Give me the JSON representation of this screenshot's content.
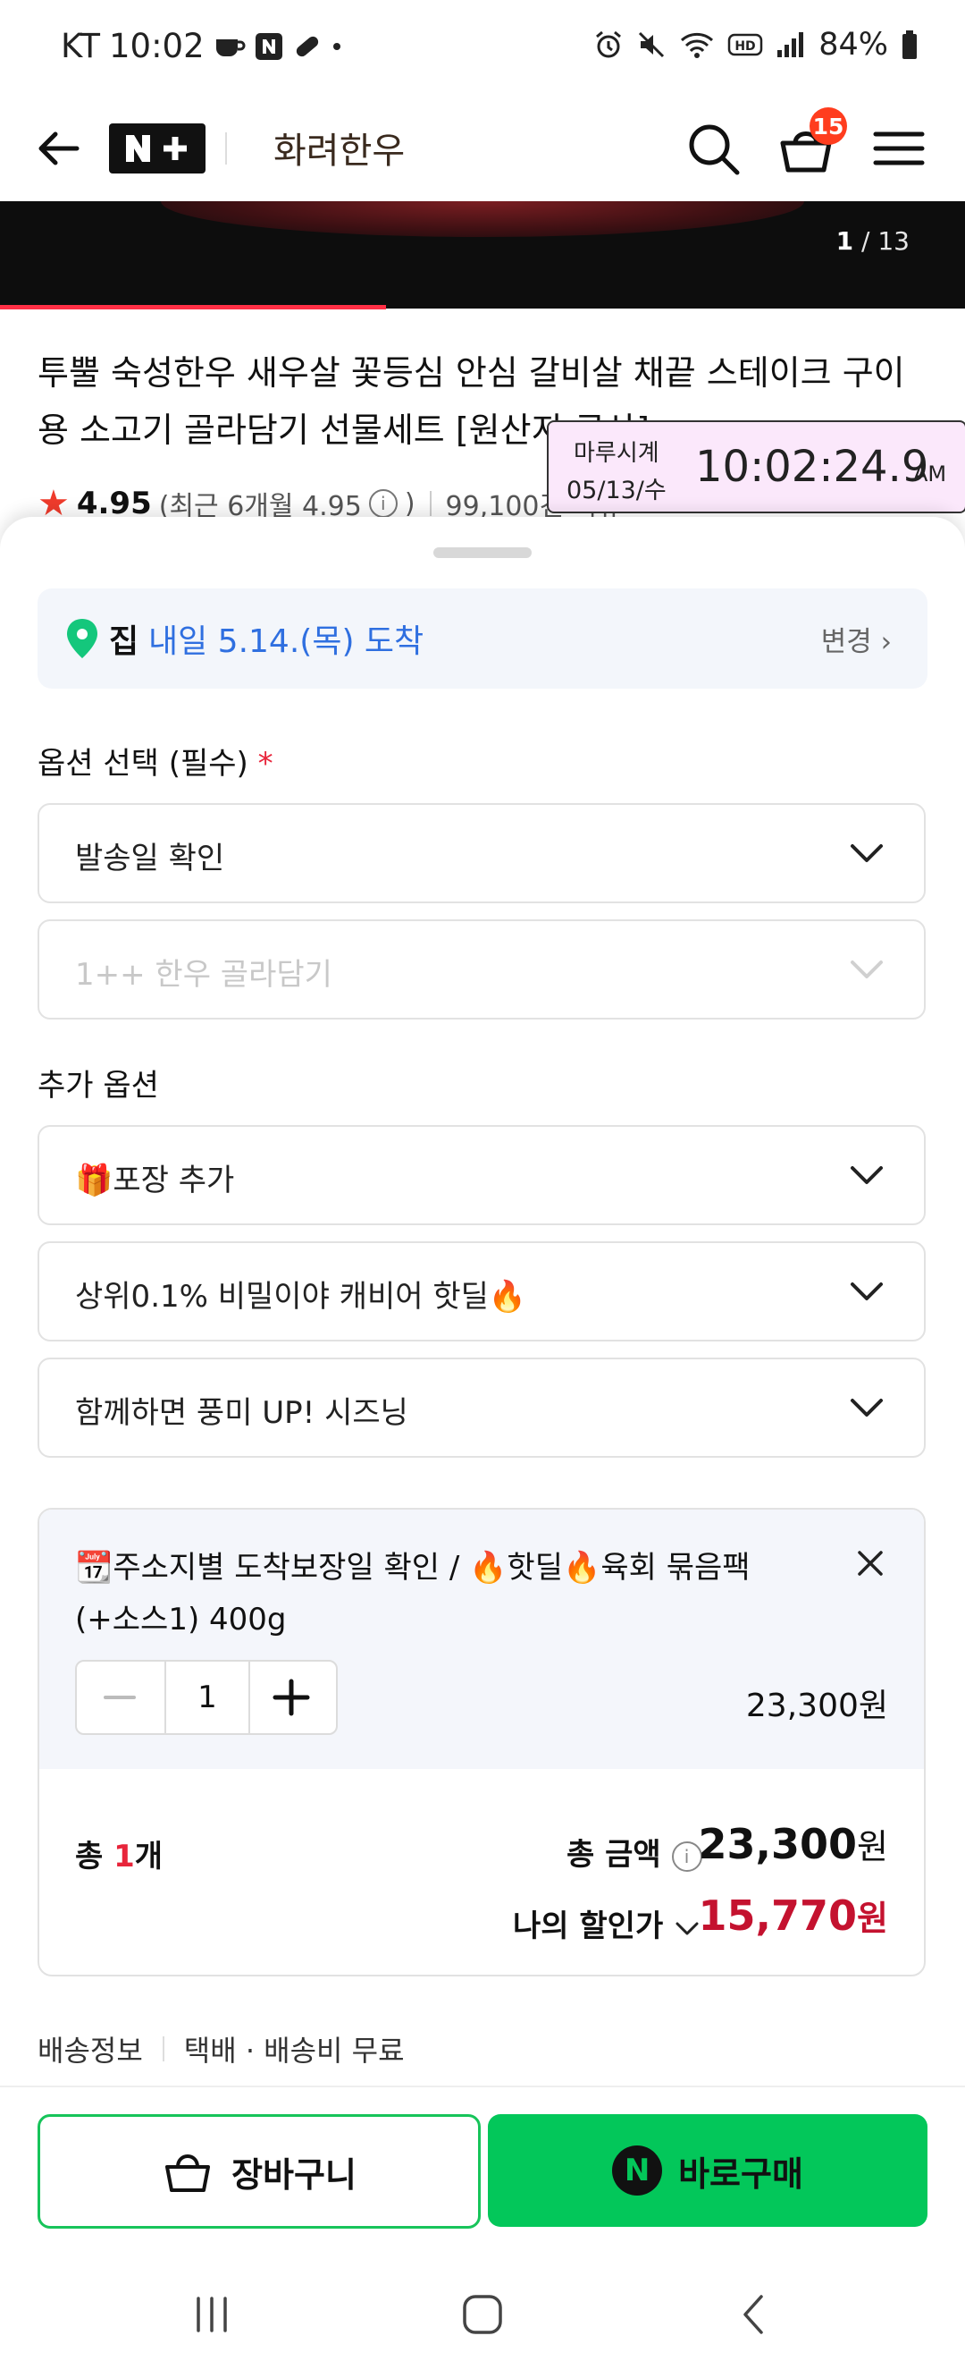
{
  "status_bar": {
    "carrier": "KT",
    "time": "10:02",
    "battery": "84%",
    "icons": [
      "coffee-icon",
      "naver-n-icon",
      "pill-icon",
      "dot-icon",
      "alarm-icon",
      "mute-icon",
      "wifi-icon",
      "hd-icon",
      "signal-icon",
      "battery-icon"
    ]
  },
  "header": {
    "logo_text": "N+",
    "shop_name": "화려한우",
    "cart_badge": "15"
  },
  "hero": {
    "counter_current": "1",
    "counter_total": "/ 13",
    "progress_fraction": 0.077
  },
  "product": {
    "title": "투뿔 숙성한우 새우살 꽃등심 안심 갈비살 채끝 스테이크 구이용 소고기 골라담기 선물세트 [원산지:국산]",
    "rating": "4.95",
    "recent": "(최근 6개월 4.95",
    "recent_info": "i",
    "recent_close": ")",
    "reviews": "99,100건 리뷰"
  },
  "clock_overlay": {
    "label": "마루시계",
    "date": "05/13/수",
    "time": "10:02:24.9",
    "ampm": "AM"
  },
  "delivery": {
    "place": "집",
    "date": "내일 5.14.(목) 도착",
    "change": "변경"
  },
  "options": {
    "required_label": "옵션 선택 (필수)",
    "required_mark": "*",
    "select1": "발송일 확인",
    "select2": "1++ 한우 골라담기",
    "additional_label": "추가 옵션",
    "add1": "🎁포장 추가",
    "add2": "상위0.1% 비밀이야 캐비어 핫딜🔥",
    "add3": "함께하면 풍미 UP! 시즈닝"
  },
  "selected_item": {
    "name": "📆주소지별 도착보장일 확인 / 🔥핫딜🔥육회 묶음팩 (+소스1) 400g",
    "quantity": "1",
    "price": "23,300원"
  },
  "totals": {
    "total_prefix": "총",
    "total_count": "1",
    "total_suffix": "개",
    "amount_label": "총 금액",
    "amount_value": "23,300",
    "amount_unit": "원",
    "discount_label": "나의 할인가",
    "discount_value": "15,770",
    "discount_unit": "원"
  },
  "shipping": {
    "label": "배송정보",
    "value": "택배 · 배송비 무료"
  },
  "actions": {
    "cart": "장바구니",
    "buy_icon_letter": "N",
    "buy": "바로구매"
  },
  "colors": {
    "accent_green": "#03c75a",
    "discount_red": "#c4122f",
    "link_blue": "#2f6fe0",
    "badge_red": "#ff3d1e"
  }
}
